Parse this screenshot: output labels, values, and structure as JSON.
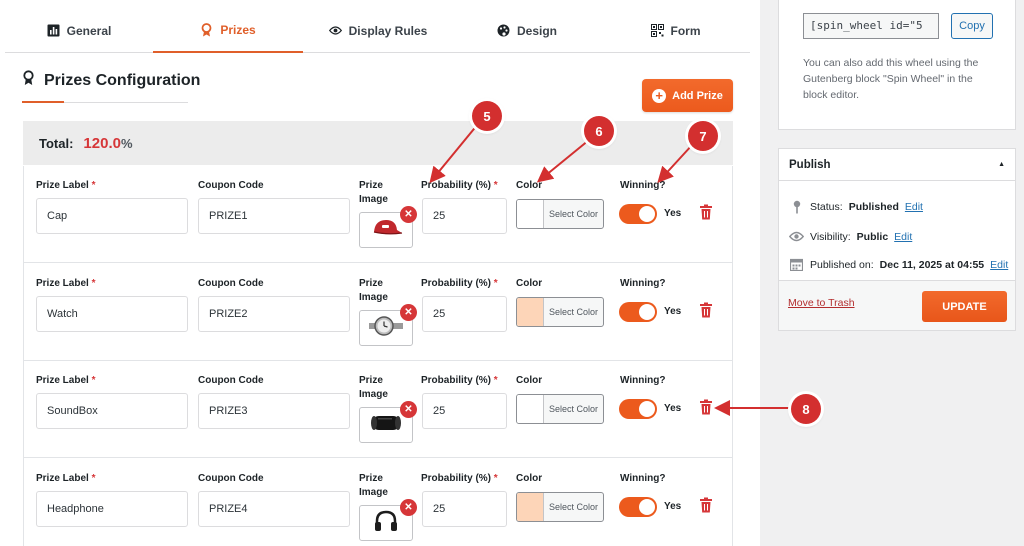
{
  "tabs": [
    {
      "label": "General",
      "icon": "chart-icon",
      "active": false
    },
    {
      "label": "Prizes",
      "icon": "award-icon",
      "active": true
    },
    {
      "label": "Display Rules",
      "icon": "eye-icon",
      "active": false
    },
    {
      "label": "Design",
      "icon": "palette-icon",
      "active": false
    },
    {
      "label": "Form",
      "icon": "qr-icon",
      "active": false
    }
  ],
  "section": {
    "title": "Prizes Configuration",
    "icon": "award-icon"
  },
  "add_prize_label": "Add Prize",
  "total": {
    "label": "Total:",
    "value": "120.0",
    "unit": "%"
  },
  "field_labels": {
    "prize_label": "Prize Label",
    "required_mark": "*",
    "coupon_code": "Coupon Code",
    "prize_image": "Prize Image",
    "probability": "Probability (%)",
    "color": "Color",
    "winning": "Winning?",
    "select_color": "Select Color",
    "yes": "Yes"
  },
  "prizes": [
    {
      "label": "Cap",
      "coupon": "PRIZE1",
      "probability": "25",
      "color": "#ffffff",
      "winning": true,
      "image_icon": "cap-icon"
    },
    {
      "label": "Watch",
      "coupon": "PRIZE2",
      "probability": "25",
      "color": "#fdd5b8",
      "winning": true,
      "image_icon": "watch-icon"
    },
    {
      "label": "SoundBox",
      "coupon": "PRIZE3",
      "probability": "25",
      "color": "#ffffff",
      "winning": true,
      "image_icon": "speaker-icon"
    },
    {
      "label": "Headphone",
      "coupon": "PRIZE4",
      "probability": "25",
      "color": "#fdd5b8",
      "winning": true,
      "image_icon": "headphone-icon"
    }
  ],
  "markers": [
    "5",
    "6",
    "7",
    "8"
  ],
  "sidebar": {
    "shortcode": "[spin_wheel id=\"5",
    "copy_label": "Copy",
    "note": "You can also add this wheel using the Gutenberg block \"Spin Wheel\" in the block editor.",
    "publish": {
      "title": "Publish",
      "status_label": "Status:",
      "status_value": "Published",
      "visibility_label": "Visibility:",
      "visibility_value": "Public",
      "published_label": "Published on:",
      "published_value": "Dec 11, 2025 at 04:55",
      "edit": "Edit",
      "trash": "Move to Trash",
      "update": "UPDATE"
    }
  },
  "colors": {
    "accent": "#ec5a1d",
    "danger": "#d63638",
    "link": "#2271b1",
    "marker": "#d32f2f"
  }
}
